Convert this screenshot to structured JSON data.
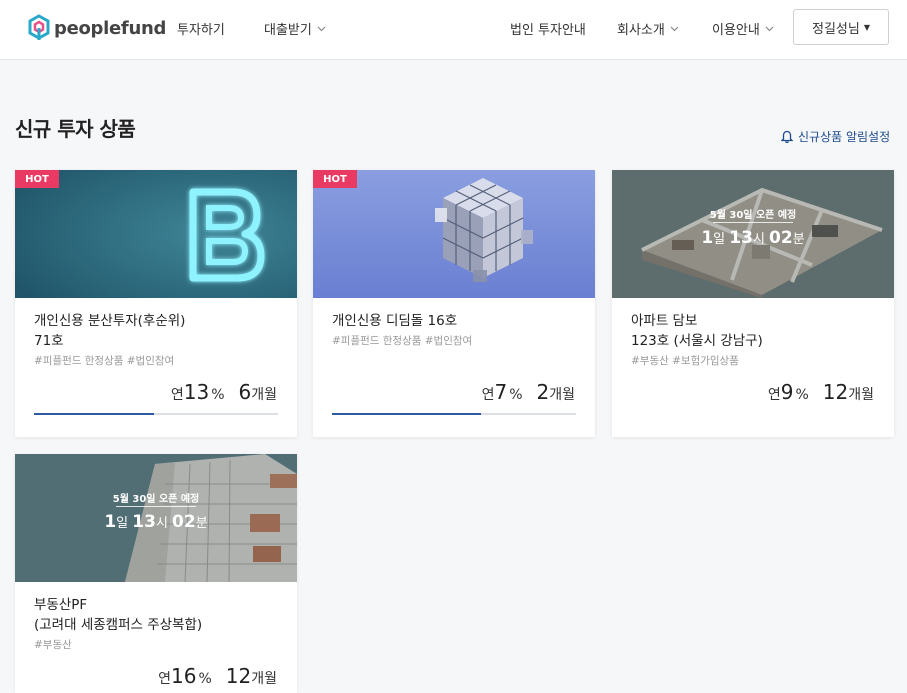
{
  "brand": {
    "name": "peoplefund"
  },
  "nav": {
    "invest": "투자하기",
    "loan": "대출받기",
    "corporate": "법인 투자안내",
    "company": "회사소개",
    "guide": "이용안내",
    "user": "정길성님"
  },
  "section": {
    "title": "신규 투자 상품",
    "alarm": "신규상품 알림설정"
  },
  "cards": [
    {
      "badge": "HOT",
      "title_line1": "개인신용 분산투자(후순위)",
      "title_line2": "71호",
      "tags": "#피플펀드 한정상품 #법인참여",
      "rate_prefix": "연",
      "rate": "13",
      "rate_unit": "%",
      "term": "6",
      "term_unit": "개월",
      "progress": 0.49
    },
    {
      "badge": "HOT",
      "title_line1": "개인신용 디딤돌 16호",
      "title_line2": "",
      "tags": "#피플펀드 한정상품 #법인참여",
      "rate_prefix": "연",
      "rate": "7",
      "rate_unit": "%",
      "term": "2",
      "term_unit": "개월",
      "progress": 0.61
    },
    {
      "open_label": "5월 30일 오픈 예정",
      "countdown": {
        "d": "1",
        "d_unit": "일",
        "h": "13",
        "h_unit": "시",
        "m": "02",
        "m_unit": "분"
      },
      "title_line1": "아파트 담보",
      "title_line2": "123호 (서울시 강남구)",
      "tags": "#부동산 #보험가입상품",
      "rate_prefix": "연",
      "rate": "9",
      "rate_unit": "%",
      "term": "12",
      "term_unit": "개월"
    },
    {
      "open_label": "5월 30일 오픈 예정",
      "countdown": {
        "d": "1",
        "d_unit": "일",
        "h": "13",
        "h_unit": "시",
        "m": "02",
        "m_unit": "분"
      },
      "title_line1": "부동산PF",
      "title_line2": "(고려대 세종캠퍼스 주상복합)",
      "tags": "#부동산",
      "rate_prefix": "연",
      "rate": "16",
      "rate_unit": "%",
      "term": "12",
      "term_unit": "개월"
    }
  ]
}
